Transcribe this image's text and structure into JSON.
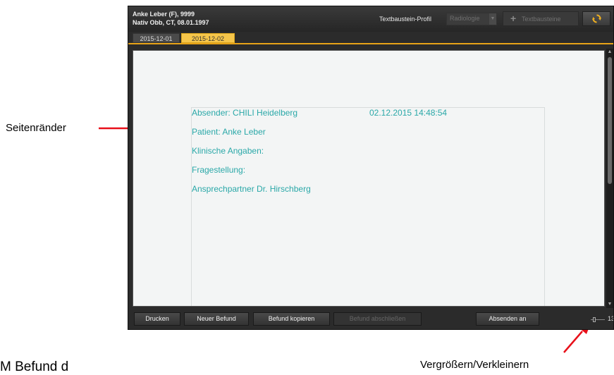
{
  "header": {
    "patient_name": "Anke Leber (F), 9999",
    "study_info": "Nativ Obb, CT, 08.01.1997",
    "profile_label": "Textbaustein-Profil",
    "profile_value": "Radiologie",
    "textbausteine_label": "Textbausteine",
    "icons": [
      "plus-icon",
      "refresh-icon",
      "chevron-down-icon"
    ]
  },
  "tabs": [
    {
      "label": "2015-12-01",
      "active": false
    },
    {
      "label": "2015-12-02",
      "active": true
    }
  ],
  "document": {
    "sender": "Absender: CHILI Heidelberg",
    "timestamp": "02.12.2015 14:48:54",
    "patient": "Patient: Anke Leber",
    "clinical": "Klinische Angaben:",
    "question": "Fragestellung:",
    "contact": "Ansprechpartner Dr. Hirschberg"
  },
  "footer": {
    "print": "Drucken",
    "new_report": "Neuer Befund",
    "copy_report": "Befund kopieren",
    "close_report": "Befund abschließen",
    "send_to": "Absenden an",
    "zoom_value": "13"
  },
  "annotations": {
    "margins": "Seitenränder",
    "zoom": "Vergrößern/Verkleinern",
    "bottom_text": "M      Befund      d"
  },
  "colors": {
    "accent": "#f6c64a",
    "doc_text": "#2aa8a8",
    "arrow": "#e8101a",
    "app_bg": "#2b2b2b"
  }
}
